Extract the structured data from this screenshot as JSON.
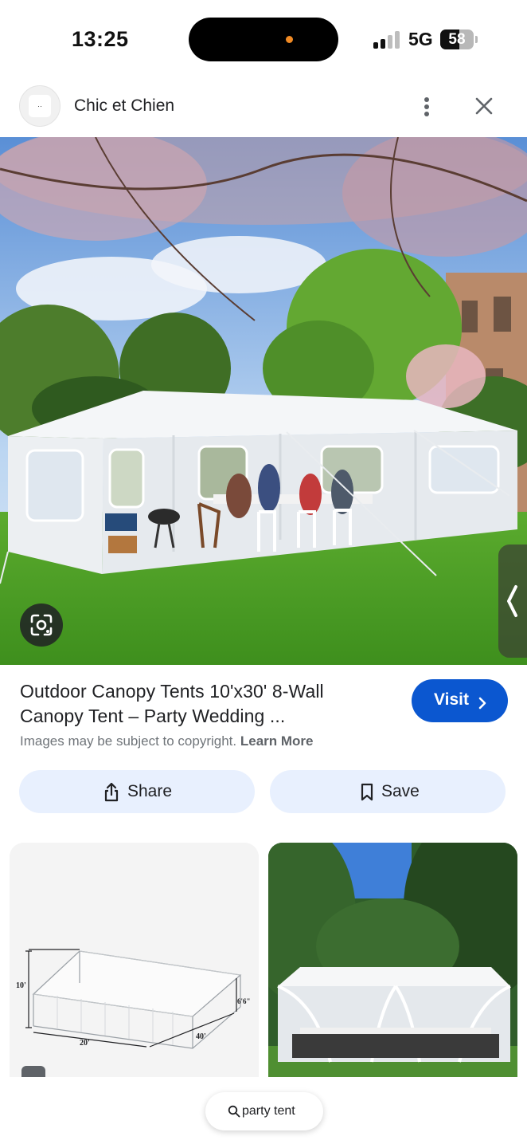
{
  "status_bar": {
    "time": "13:25",
    "network": "5G",
    "battery": "58",
    "battery_level": 0.58
  },
  "header": {
    "site_name": "Chic et Chien",
    "logo_text": "··"
  },
  "result": {
    "title_line1": "Outdoor Canopy Tents 10'x30' 8-Wall",
    "title_line2": "Canopy Tent – Party Wedding ...",
    "visit_label": "Visit",
    "copyright_text": "Images may be subject to copyright.",
    "learn_more": "Learn More",
    "share_label": "Share",
    "save_label": "Save"
  },
  "related": {
    "dimension_labels": {
      "height": "10'",
      "side_height": "6'6\"",
      "width": "20'",
      "length": "40'"
    }
  },
  "bottom": {
    "query": "party tent"
  },
  "colors": {
    "accent": "#0b57d0",
    "action_bg": "#e8f0fe",
    "text": "#202124",
    "muted": "#70757a"
  },
  "icons": [
    "more-vert-icon",
    "close-icon",
    "lens-icon",
    "chevron-left-icon",
    "chevron-right-icon",
    "share-icon",
    "bookmark-icon",
    "search-icon"
  ]
}
